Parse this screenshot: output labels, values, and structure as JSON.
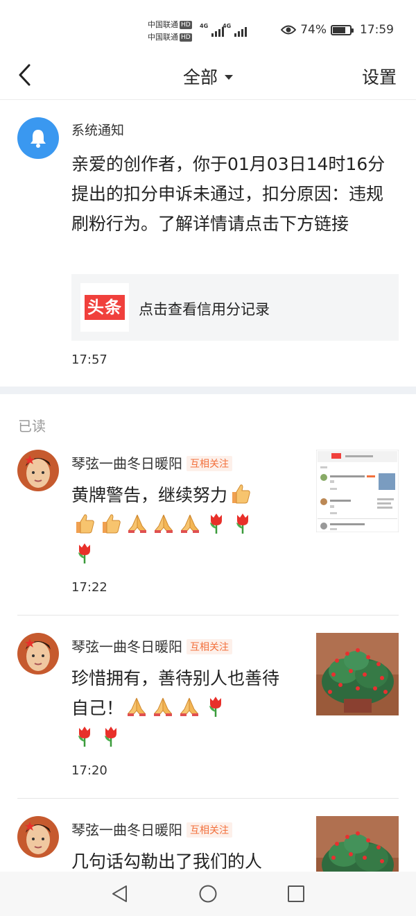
{
  "status_bar": {
    "carrier_1": "中国联通",
    "carrier_2": "中国联通",
    "hd_badge": "HD",
    "network": "4G",
    "battery_percent": "74%",
    "battery_level": 0.74,
    "time": "17:59"
  },
  "header": {
    "title": "全部",
    "settings": "设置"
  },
  "system_notice": {
    "name": "系统通知",
    "text": "亲爱的创作者，你于01月03日14时16分提出的扣分申诉未通过，扣分原因：违规刷粉行为。了解详情请点击下方链接",
    "link_logo": "头条",
    "link_text": "点击查看信用分记录",
    "time": "17:57"
  },
  "section_read_label": "已读",
  "messages": [
    {
      "name": "琴弦一曲冬日暖阳",
      "tag": "互相关注",
      "text": "黄牌警告，继续努力",
      "time": "17:22"
    },
    {
      "name": "琴弦一曲冬日暖阳",
      "tag": "互相关注",
      "text": "珍惜拥有，善待别人也善待自己！",
      "time": "17:20"
    },
    {
      "name": "琴弦一曲冬日暖阳",
      "tag": "互相关注",
      "text": "几句话勾勒出了我们的人"
    }
  ],
  "colors": {
    "accent_blue": "#3a98f0",
    "tag_orange": "#f2703c",
    "logo_red": "#f0403c"
  }
}
